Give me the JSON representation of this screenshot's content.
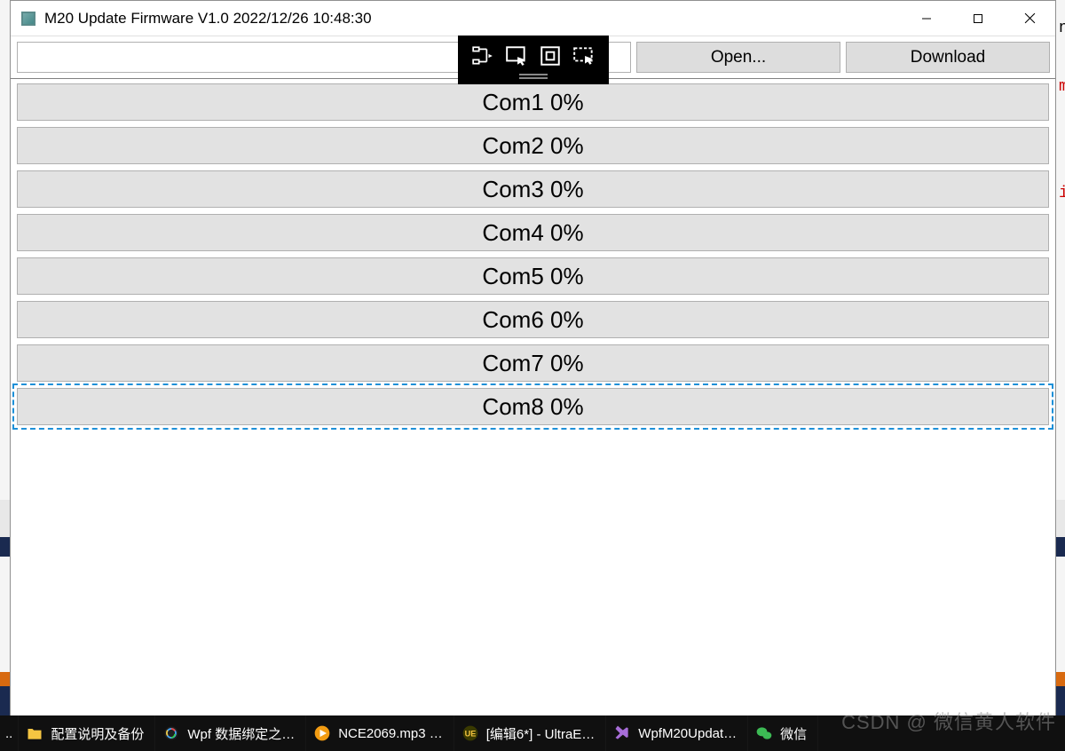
{
  "window": {
    "title": "M20 Update Firmware V1.0   2022/12/26 10:48:30"
  },
  "toolbar": {
    "open_label": "Open...",
    "download_label": "Download"
  },
  "progress": [
    {
      "text": "Com1    0%",
      "selected": false
    },
    {
      "text": "Com2    0%",
      "selected": false
    },
    {
      "text": "Com3    0%",
      "selected": false
    },
    {
      "text": "Com4    0%",
      "selected": false
    },
    {
      "text": "Com5    0%",
      "selected": false
    },
    {
      "text": "Com6    0%",
      "selected": false
    },
    {
      "text": "Com7    0%",
      "selected": false
    },
    {
      "text": "Com8    0%",
      "selected": true
    }
  ],
  "watermark": "CSDN @ 微信黄人软件",
  "taskbar": {
    "items": [
      {
        "label": "配置说明及备份",
        "icon": "folder"
      },
      {
        "label": "Wpf 数据绑定之…",
        "icon": "browser"
      },
      {
        "label": "NCE2069.mp3 …",
        "icon": "media"
      },
      {
        "label": "[编辑6*] - UltraE…",
        "icon": "ue"
      },
      {
        "label": "WpfM20Updat…",
        "icon": "vs"
      },
      {
        "label": "微信",
        "icon": "wechat"
      }
    ]
  }
}
